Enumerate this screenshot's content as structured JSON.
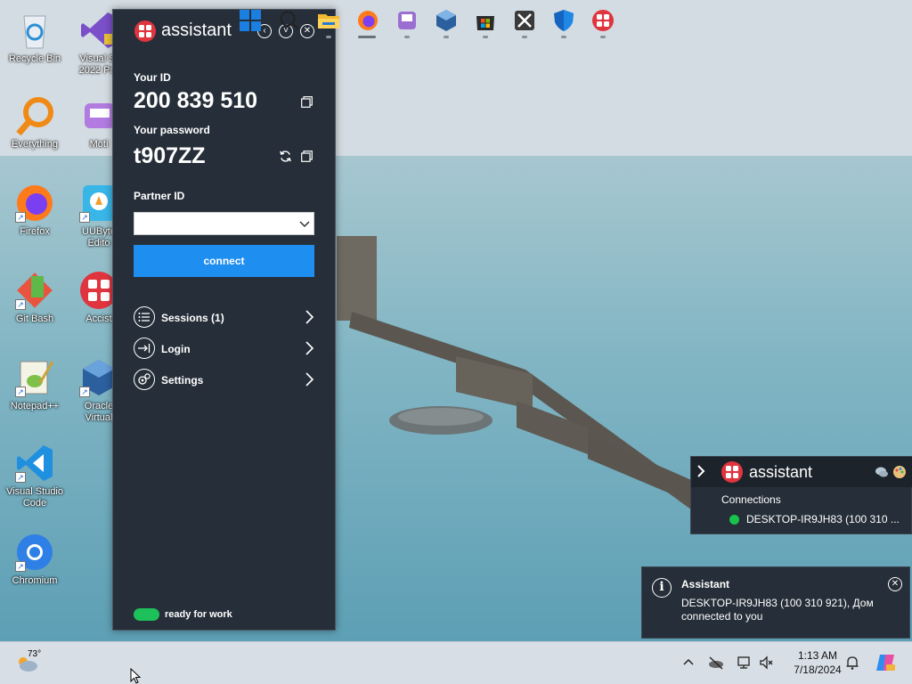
{
  "desktop": {
    "icons_left": [
      {
        "label": "Recycle Bin",
        "icon": "recycle-bin-icon"
      },
      {
        "label": "Everything",
        "icon": "everything-search-icon"
      },
      {
        "label": "Firefox",
        "icon": "firefox-icon"
      },
      {
        "label": "Git Bash",
        "icon": "git-bash-icon"
      },
      {
        "label": "Notepad++",
        "icon": "notepad-plus-plus-icon"
      },
      {
        "label": "Visual Studio Code",
        "line1": "Visual Studio",
        "line2": "Code",
        "icon": "vscode-icon"
      },
      {
        "label": "Chromium",
        "icon": "chromium-icon"
      }
    ],
    "icons_right_partial": [
      {
        "line1": "Visual St",
        "line2": "2022 Pre",
        "icon": "visual-studio-icon"
      },
      {
        "line1": "Moti",
        "icon": "moti-icon"
      },
      {
        "line1": "UUByte",
        "line2": "Edito",
        "icon": "uubyte-icon"
      },
      {
        "line1": "Accist",
        "icon": "assistant-desktop-icon"
      },
      {
        "line1": "Oracle",
        "line2": "Virtual",
        "icon": "virtualbox-icon"
      }
    ]
  },
  "main_window": {
    "title": "assistant",
    "your_id_label": "Your ID",
    "your_id": "200 839 510",
    "password_label": "Your password",
    "password": "t907ZZ",
    "partner_id_label": "Partner ID",
    "partner_id_value": "",
    "connect_label": "connect",
    "menu": [
      {
        "label": "Sessions (1)",
        "icon": "list-icon"
      },
      {
        "label": "Login",
        "icon": "login-arrow-icon"
      },
      {
        "label": "Settings",
        "icon": "gears-icon"
      }
    ],
    "status": "ready for work",
    "status_color": "#1ec05a",
    "connect_color": "#1f8ef1"
  },
  "tray_popup": {
    "title": "assistant",
    "section": "Connections",
    "connection": "DESKTOP-IR9JH83 (100 310 ..."
  },
  "toast": {
    "title": "Assistant",
    "line1": "DESKTOP-IR9JH83 (100 310 921), Дом",
    "line2": "connected to you"
  },
  "taskbar": {
    "weather_temp": "73°",
    "time": "1:13 AM",
    "date": "7/18/2024",
    "apps": [
      "start-icon",
      "search-icon",
      "file-explorer-icon",
      "firefox-icon",
      "purple-app-icon",
      "virtualbox-icon",
      "microsoft-store-icon",
      "capcut-icon",
      "defender-shield-icon",
      "assistant-taskbar-icon"
    ]
  }
}
